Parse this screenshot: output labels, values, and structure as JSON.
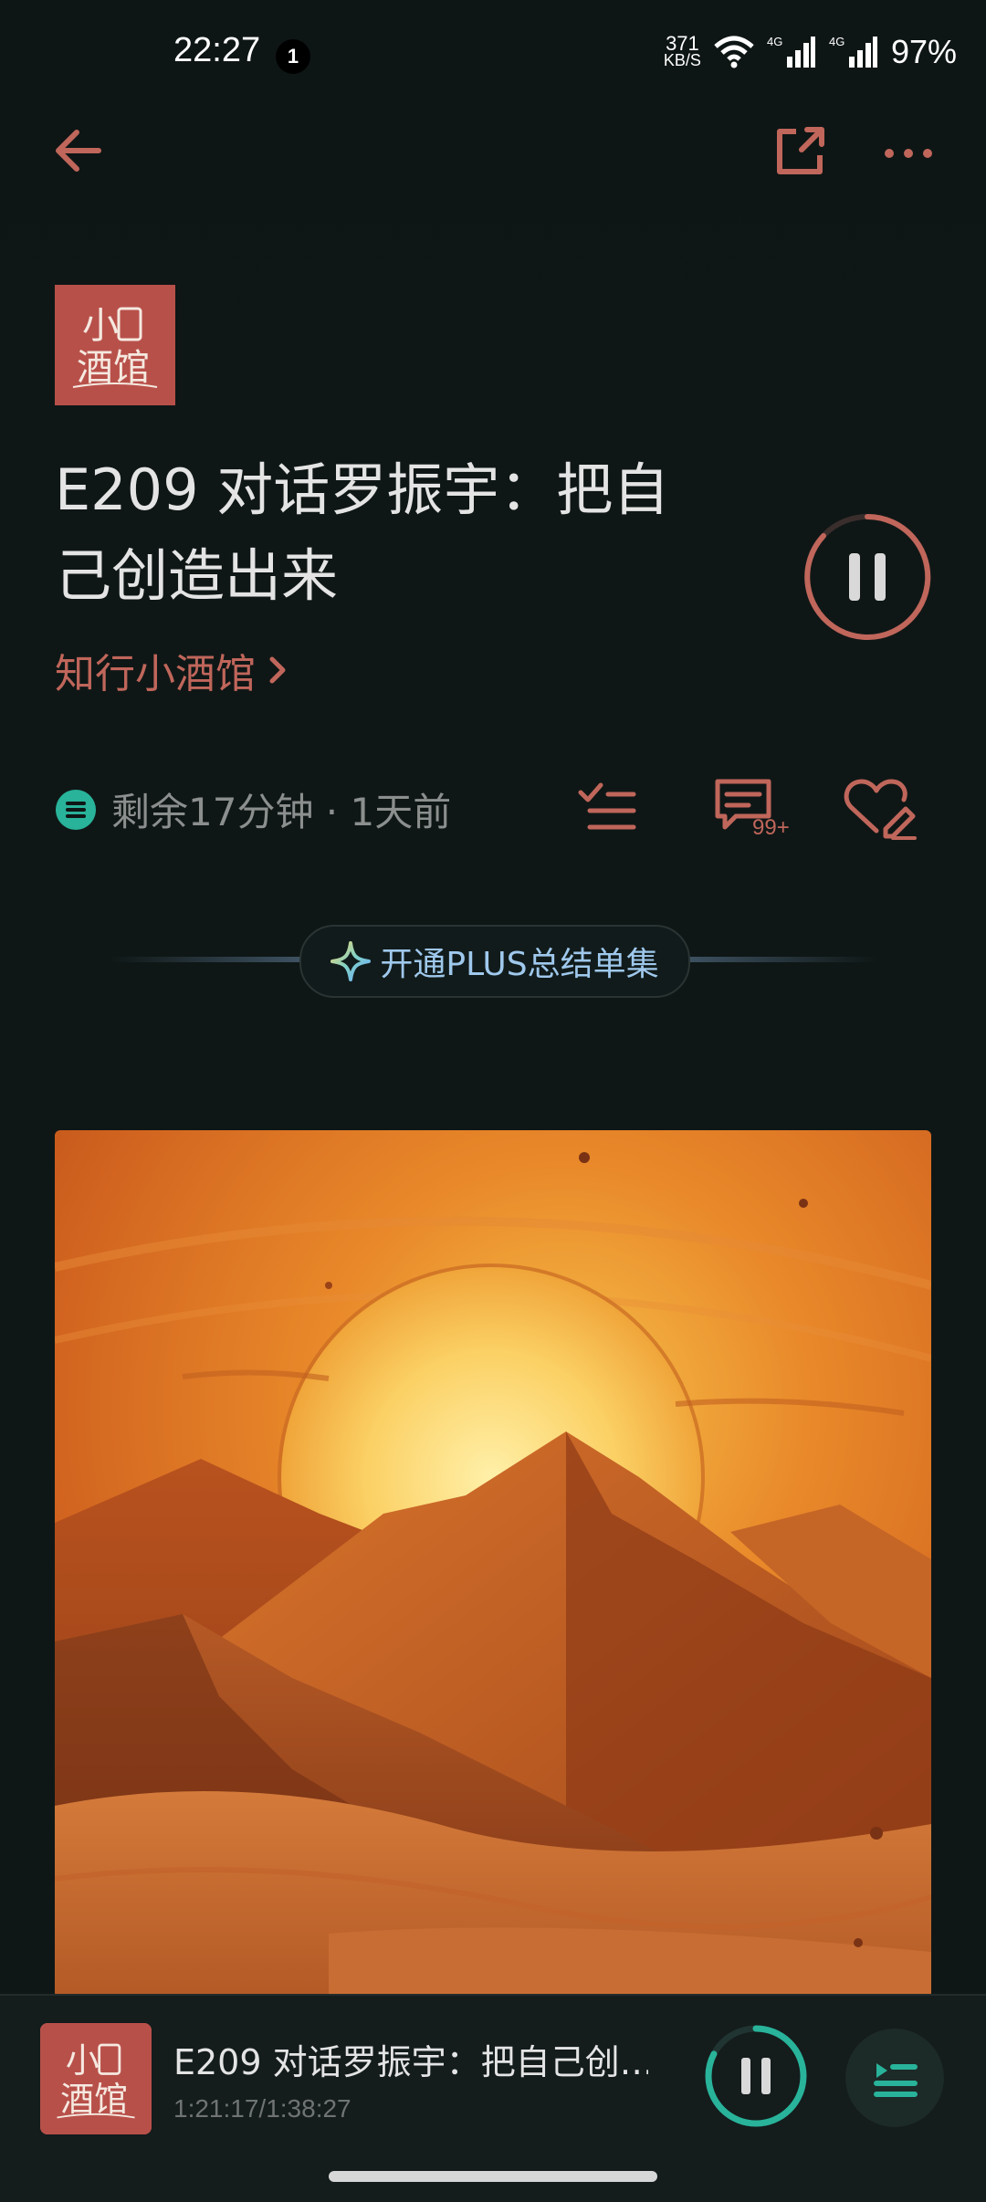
{
  "status_bar": {
    "time": "22:27",
    "notification_count": "1",
    "net_speed_value": "371",
    "net_speed_unit": "KB/S",
    "signal1_label": "4G",
    "signal2_label": "4G",
    "battery": "97%",
    "icons": [
      "wifi-icon",
      "signal-icon",
      "signal-icon"
    ]
  },
  "nav": {
    "icons": [
      "back-arrow-icon",
      "share-icon",
      "more-icon"
    ]
  },
  "podcast": {
    "logo_text_top": "小",
    "logo_text_bottom": "酒馆",
    "name": "知行小酒馆",
    "name_chevron": "›"
  },
  "episode": {
    "title": "E209 对话罗振宇：把自己创造出来",
    "remaining": "剩余17分钟 · 1天前",
    "comment_count": "99+",
    "playing": true
  },
  "plus_banner": {
    "label": "开通PLUS总结单集"
  },
  "mini_player": {
    "title": "E209 对话罗振宇：把自己创…",
    "time": "1:21:17/1:38:27",
    "progress": 0.826
  },
  "colors": {
    "background": "#0f1716",
    "accent": "#c0665b",
    "teal": "#28b39a",
    "plus_text": "#9fc8ec"
  }
}
